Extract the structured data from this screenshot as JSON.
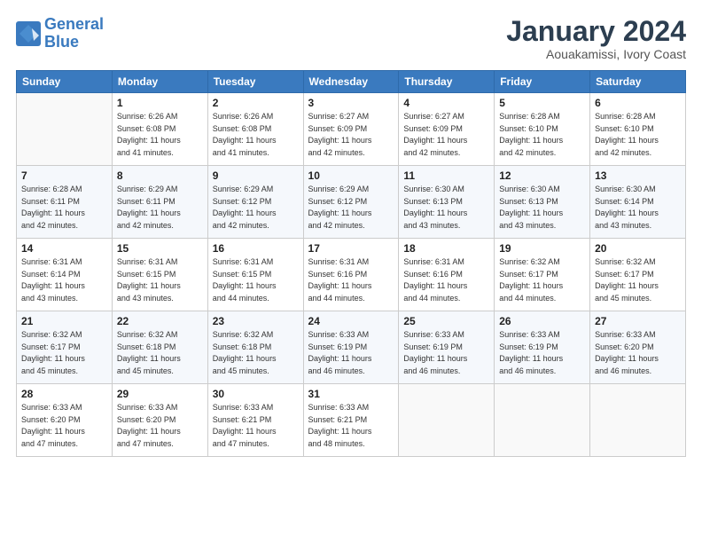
{
  "header": {
    "logo_line1": "General",
    "logo_line2": "Blue",
    "title": "January 2024",
    "subtitle": "Aouakamissi, Ivory Coast"
  },
  "weekdays": [
    "Sunday",
    "Monday",
    "Tuesday",
    "Wednesday",
    "Thursday",
    "Friday",
    "Saturday"
  ],
  "weeks": [
    [
      {
        "day": "",
        "info": ""
      },
      {
        "day": "1",
        "info": "Sunrise: 6:26 AM\nSunset: 6:08 PM\nDaylight: 11 hours\nand 41 minutes."
      },
      {
        "day": "2",
        "info": "Sunrise: 6:26 AM\nSunset: 6:08 PM\nDaylight: 11 hours\nand 41 minutes."
      },
      {
        "day": "3",
        "info": "Sunrise: 6:27 AM\nSunset: 6:09 PM\nDaylight: 11 hours\nand 42 minutes."
      },
      {
        "day": "4",
        "info": "Sunrise: 6:27 AM\nSunset: 6:09 PM\nDaylight: 11 hours\nand 42 minutes."
      },
      {
        "day": "5",
        "info": "Sunrise: 6:28 AM\nSunset: 6:10 PM\nDaylight: 11 hours\nand 42 minutes."
      },
      {
        "day": "6",
        "info": "Sunrise: 6:28 AM\nSunset: 6:10 PM\nDaylight: 11 hours\nand 42 minutes."
      }
    ],
    [
      {
        "day": "7",
        "info": "Sunrise: 6:28 AM\nSunset: 6:11 PM\nDaylight: 11 hours\nand 42 minutes."
      },
      {
        "day": "8",
        "info": "Sunrise: 6:29 AM\nSunset: 6:11 PM\nDaylight: 11 hours\nand 42 minutes."
      },
      {
        "day": "9",
        "info": "Sunrise: 6:29 AM\nSunset: 6:12 PM\nDaylight: 11 hours\nand 42 minutes."
      },
      {
        "day": "10",
        "info": "Sunrise: 6:29 AM\nSunset: 6:12 PM\nDaylight: 11 hours\nand 42 minutes."
      },
      {
        "day": "11",
        "info": "Sunrise: 6:30 AM\nSunset: 6:13 PM\nDaylight: 11 hours\nand 43 minutes."
      },
      {
        "day": "12",
        "info": "Sunrise: 6:30 AM\nSunset: 6:13 PM\nDaylight: 11 hours\nand 43 minutes."
      },
      {
        "day": "13",
        "info": "Sunrise: 6:30 AM\nSunset: 6:14 PM\nDaylight: 11 hours\nand 43 minutes."
      }
    ],
    [
      {
        "day": "14",
        "info": "Sunrise: 6:31 AM\nSunset: 6:14 PM\nDaylight: 11 hours\nand 43 minutes."
      },
      {
        "day": "15",
        "info": "Sunrise: 6:31 AM\nSunset: 6:15 PM\nDaylight: 11 hours\nand 43 minutes."
      },
      {
        "day": "16",
        "info": "Sunrise: 6:31 AM\nSunset: 6:15 PM\nDaylight: 11 hours\nand 44 minutes."
      },
      {
        "day": "17",
        "info": "Sunrise: 6:31 AM\nSunset: 6:16 PM\nDaylight: 11 hours\nand 44 minutes."
      },
      {
        "day": "18",
        "info": "Sunrise: 6:31 AM\nSunset: 6:16 PM\nDaylight: 11 hours\nand 44 minutes."
      },
      {
        "day": "19",
        "info": "Sunrise: 6:32 AM\nSunset: 6:17 PM\nDaylight: 11 hours\nand 44 minutes."
      },
      {
        "day": "20",
        "info": "Sunrise: 6:32 AM\nSunset: 6:17 PM\nDaylight: 11 hours\nand 45 minutes."
      }
    ],
    [
      {
        "day": "21",
        "info": "Sunrise: 6:32 AM\nSunset: 6:17 PM\nDaylight: 11 hours\nand 45 minutes."
      },
      {
        "day": "22",
        "info": "Sunrise: 6:32 AM\nSunset: 6:18 PM\nDaylight: 11 hours\nand 45 minutes."
      },
      {
        "day": "23",
        "info": "Sunrise: 6:32 AM\nSunset: 6:18 PM\nDaylight: 11 hours\nand 45 minutes."
      },
      {
        "day": "24",
        "info": "Sunrise: 6:33 AM\nSunset: 6:19 PM\nDaylight: 11 hours\nand 46 minutes."
      },
      {
        "day": "25",
        "info": "Sunrise: 6:33 AM\nSunset: 6:19 PM\nDaylight: 11 hours\nand 46 minutes."
      },
      {
        "day": "26",
        "info": "Sunrise: 6:33 AM\nSunset: 6:19 PM\nDaylight: 11 hours\nand 46 minutes."
      },
      {
        "day": "27",
        "info": "Sunrise: 6:33 AM\nSunset: 6:20 PM\nDaylight: 11 hours\nand 46 minutes."
      }
    ],
    [
      {
        "day": "28",
        "info": "Sunrise: 6:33 AM\nSunset: 6:20 PM\nDaylight: 11 hours\nand 47 minutes."
      },
      {
        "day": "29",
        "info": "Sunrise: 6:33 AM\nSunset: 6:20 PM\nDaylight: 11 hours\nand 47 minutes."
      },
      {
        "day": "30",
        "info": "Sunrise: 6:33 AM\nSunset: 6:21 PM\nDaylight: 11 hours\nand 47 minutes."
      },
      {
        "day": "31",
        "info": "Sunrise: 6:33 AM\nSunset: 6:21 PM\nDaylight: 11 hours\nand 48 minutes."
      },
      {
        "day": "",
        "info": ""
      },
      {
        "day": "",
        "info": ""
      },
      {
        "day": "",
        "info": ""
      }
    ]
  ]
}
